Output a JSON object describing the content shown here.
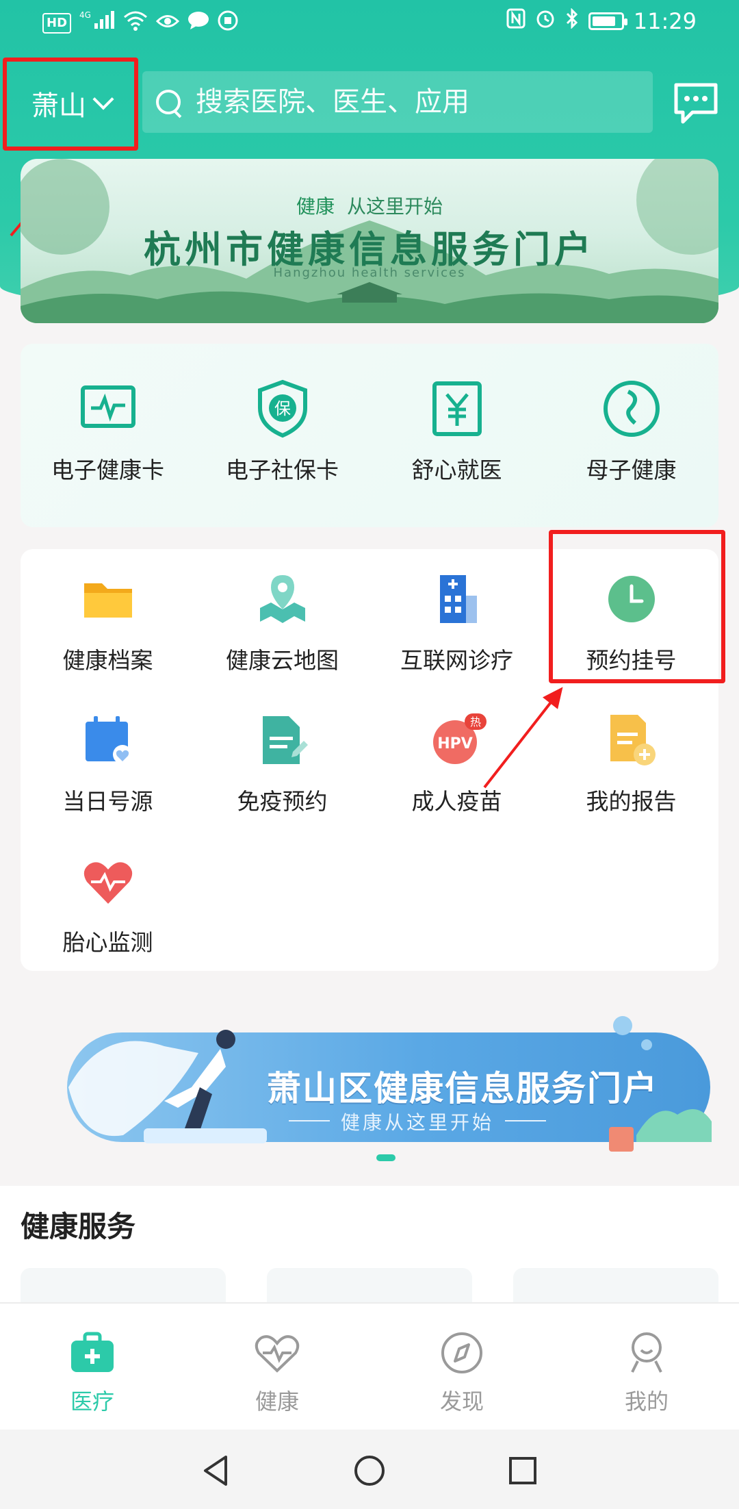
{
  "colors": {
    "accent": "#2ccaa9",
    "highlight": "#f11e1e"
  },
  "status_bar": {
    "time": "11:29",
    "network": "4G",
    "hd": "HD",
    "battery_level": 0.8
  },
  "header": {
    "city": "萧山",
    "search_placeholder": "搜索医院、医生、应用",
    "message_icon": "chat-bubble-icon"
  },
  "banner": {
    "tag_strong": "健康",
    "tag": "从这里开始",
    "title": "杭州市健康信息服务门户",
    "subtitle": "Hangzhou health services"
  },
  "quick_services": [
    {
      "label": "电子健康卡",
      "icon": "health-card-icon"
    },
    {
      "label": "电子社保卡",
      "icon": "social-security-shield-icon"
    },
    {
      "label": "舒心就医",
      "icon": "yuan-document-icon"
    },
    {
      "label": "母子健康",
      "icon": "mother-child-icon"
    }
  ],
  "services": [
    {
      "label": "健康档案",
      "icon": "folder-icon"
    },
    {
      "label": "健康云地图",
      "icon": "map-pin-icon"
    },
    {
      "label": "互联网诊疗",
      "icon": "hospital-building-icon"
    },
    {
      "label": "预约挂号",
      "icon": "clock-icon"
    },
    {
      "label": "当日号源",
      "icon": "calendar-heart-icon"
    },
    {
      "label": "免疫预约",
      "icon": "document-edit-icon"
    },
    {
      "label": "成人疫苗",
      "icon": "hpv-badge-icon",
      "badge": "热",
      "badge_text": "HPV"
    },
    {
      "label": "我的报告",
      "icon": "report-add-icon"
    },
    {
      "label": "胎心监测",
      "icon": "heartbeat-icon"
    }
  ],
  "promo": {
    "title": "萧山区健康信息服务门户",
    "subtitle": "健康从这里开始"
  },
  "section": {
    "title": "健康服务"
  },
  "tabs": [
    {
      "label": "医疗",
      "icon": "medical-kit-icon",
      "active": true
    },
    {
      "label": "健康",
      "icon": "heart-pulse-icon",
      "active": false
    },
    {
      "label": "发现",
      "icon": "compass-icon",
      "active": false
    },
    {
      "label": "我的",
      "icon": "person-icon",
      "active": false
    }
  ],
  "system_nav": [
    "back-icon",
    "home-icon",
    "recents-icon"
  ]
}
